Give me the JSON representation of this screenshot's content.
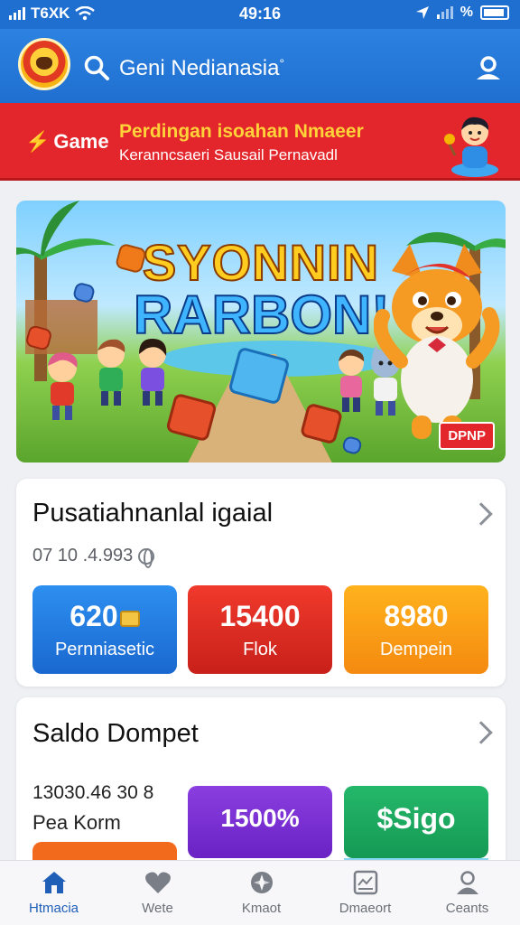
{
  "status_bar": {
    "carrier": "T6XK",
    "time": "49:16",
    "battery_text": "%"
  },
  "header": {
    "title": "Geni Nedianasia",
    "title_mark": "°"
  },
  "promo": {
    "tag": "Game",
    "line1": "Perdingan isoahan Nmaeer",
    "line2": "Keranncsaeri Sausail Pernavadl"
  },
  "hero": {
    "title_line1": "SYONNIN",
    "title_line2": "RARBON!",
    "badge": "DPNP"
  },
  "card1": {
    "title": "Pusatiahnanlal igaial",
    "subtitle": "07 10 .4.993",
    "tiles": [
      {
        "value": "620",
        "label": "Pernniasetic",
        "color": "#1f77dc"
      },
      {
        "value": "15400",
        "label": "Flok",
        "color": "#e02a22"
      },
      {
        "value": "8980",
        "label": "Dempein",
        "color": "#f9a01a"
      }
    ]
  },
  "card2": {
    "title": "Saldo Dompet",
    "balance_value": "13030.46 30 8",
    "balance_label": "Pea Korm",
    "tiles": [
      {
        "value": "1500%",
        "color": "#7a30d6"
      },
      {
        "value": "$Sigo",
        "color": "#1ea85f"
      }
    ]
  },
  "nav": [
    {
      "label": "Htmacia",
      "icon": "home-icon",
      "active": true
    },
    {
      "label": "Wete",
      "icon": "heart-icon",
      "active": false
    },
    {
      "label": "Kmaot",
      "icon": "compass-icon",
      "active": false
    },
    {
      "label": "Dmaeort",
      "icon": "document-icon",
      "active": false
    },
    {
      "label": "Ceants",
      "icon": "profile-icon",
      "active": false
    }
  ]
}
